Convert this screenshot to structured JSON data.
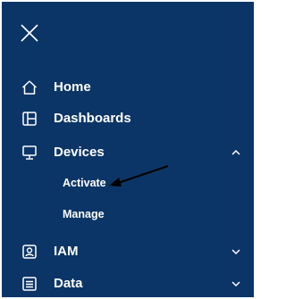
{
  "menu": {
    "close_icon": "close-icon",
    "items": [
      {
        "label": "Home",
        "icon": "home-icon",
        "expandable": false
      },
      {
        "label": "Dashboards",
        "icon": "dashboards-icon",
        "expandable": false
      },
      {
        "label": "Devices",
        "icon": "devices-icon",
        "expandable": true,
        "expanded": true,
        "subitems": [
          {
            "label": "Activate"
          },
          {
            "label": "Manage"
          }
        ]
      },
      {
        "label": "IAM",
        "icon": "iam-icon",
        "expandable": true,
        "expanded": false
      },
      {
        "label": "Data",
        "icon": "data-icon",
        "expandable": true,
        "expanded": false
      }
    ]
  },
  "colors": {
    "background": "#0b3566",
    "text": "#ffffff",
    "annotation_arrow": "#000000"
  }
}
